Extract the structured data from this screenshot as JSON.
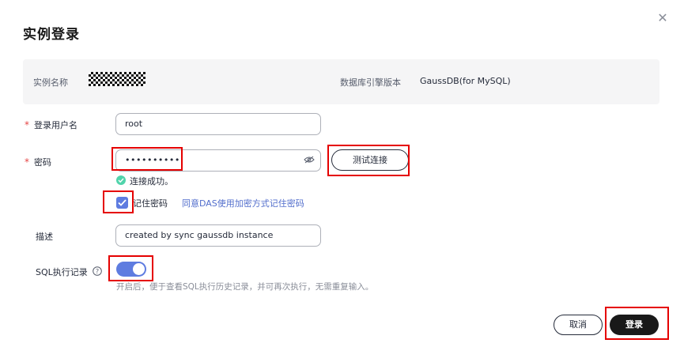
{
  "dialog": {
    "title": "实例登录",
    "close_icon": "close-icon"
  },
  "info": {
    "instance_name_label": "实例名称",
    "engine_version_label": "数据库引擎版本",
    "engine_version_value": "GaussDB(for MySQL)"
  },
  "form": {
    "required_mark": "*",
    "username_label": "登录用户名",
    "username_value": "root",
    "password_label": "密码",
    "password_value": "••••••••••",
    "test_button": "测试连接",
    "success_text": "连接成功。",
    "remember_label": "记住密码",
    "remember_checked": true,
    "consent_link": "同意DAS使用加密方式记住密码",
    "desc_label": "描述",
    "desc_value": "created by sync gaussdb instance",
    "sql_record_label": "SQL执行记录",
    "sql_record_enabled": true,
    "sql_record_hint": "开启后，便于查看SQL执行历史记录，并可再次执行，无需重复输入。"
  },
  "footer": {
    "cancel_button": "取消",
    "login_button": "登录"
  },
  "colors": {
    "accent": "#5e7ce0",
    "success": "#50d4ab",
    "highlight": "#e50000",
    "primary_button": "#191919",
    "link": "#526ecc"
  }
}
